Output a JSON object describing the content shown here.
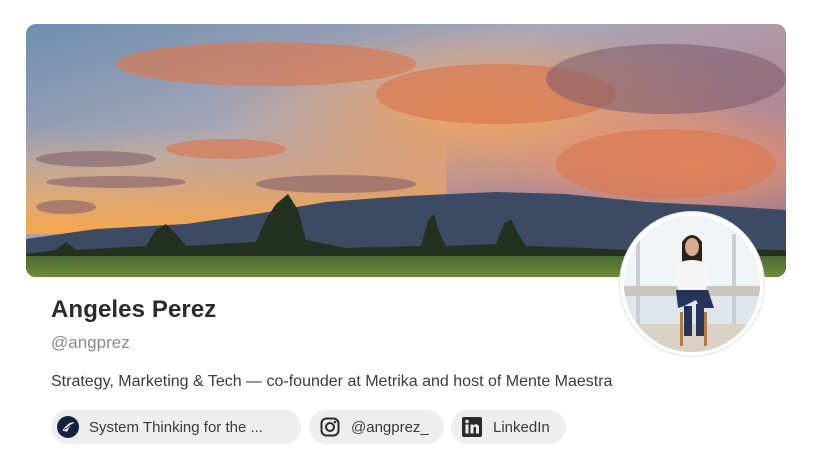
{
  "profile": {
    "name": "Angeles Perez",
    "handle": "@angprez",
    "bio": "Strategy, Marketing & Tech — co-founder at Metrika and host of Mente Maestra"
  },
  "links": [
    {
      "label": "System Thinking for the ...",
      "icon": "podcast-logo-icon"
    },
    {
      "label": "@angprez_",
      "icon": "instagram-icon"
    },
    {
      "label": "LinkedIn",
      "icon": "linkedin-icon"
    }
  ],
  "colors": {
    "chip_bg": "#eeeeee",
    "name_text": "#2b2b2b",
    "handle_text": "#8a8a8a"
  }
}
